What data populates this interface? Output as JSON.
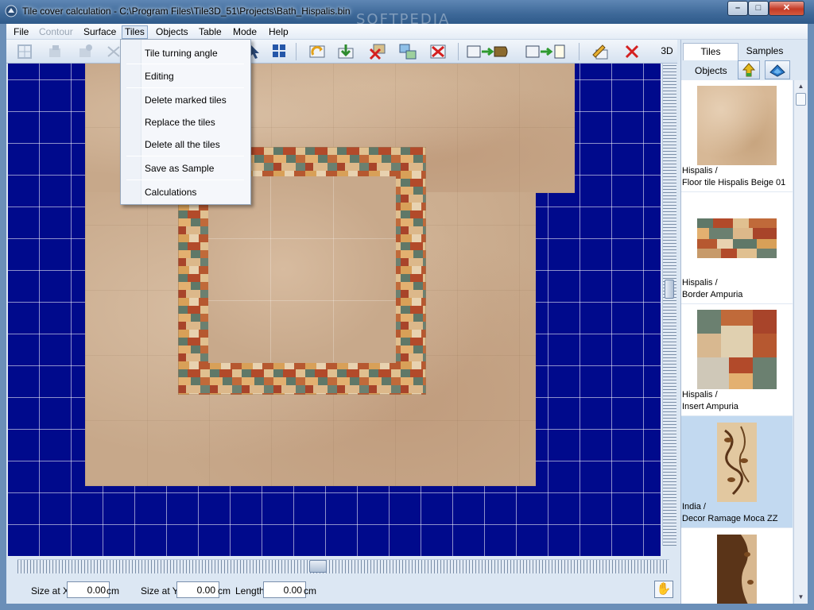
{
  "window": {
    "title": "Tile cover calculation - C:\\Program Files\\Tile3D_51\\Projects\\Bath_Hispalis.bin",
    "watermark": "SOFTPEDIA",
    "min_label": "–",
    "max_label": "□",
    "close_label": "✕"
  },
  "menubar": {
    "file": "File",
    "contour": "Contour",
    "surface": "Surface",
    "tiles": "Tiles",
    "objects": "Objects",
    "table": "Table",
    "mode": "Mode",
    "help": "Help"
  },
  "tiles_menu": {
    "turning_angle": "Tile turning angle",
    "editing": "Editing",
    "delete_marked": "Delete marked tiles",
    "replace": "Replace the tiles",
    "delete_all": "Delete all the tiles",
    "save_sample": "Save as Sample",
    "calculations": "Calculations"
  },
  "toolbar": {
    "three_d_label": "3D"
  },
  "status": {
    "size_x_label": "Size at X",
    "size_x_value": "0.00",
    "size_y_label": "Size at Y",
    "size_y_value": "0.00",
    "length_label": "Length",
    "length_value": "0.00",
    "unit": "cm"
  },
  "panel": {
    "tab_tiles": "Tiles",
    "tab_samples": "Samples",
    "objects_label": "Objects",
    "items": [
      {
        "brand": "Hispalis /",
        "name": "Floor tile Hispalis Beige 01"
      },
      {
        "brand": "Hispalis /",
        "name": "Border Ampuria"
      },
      {
        "brand": "Hispalis /",
        "name": "Insert Ampuria"
      },
      {
        "brand": "India /",
        "name": "Decor Ramage Moca ZZ"
      }
    ]
  },
  "colors": {
    "canvas_bg": "#000a8c",
    "tile_beige": "#c7a88a",
    "selected_item": "#c2d9f0"
  }
}
